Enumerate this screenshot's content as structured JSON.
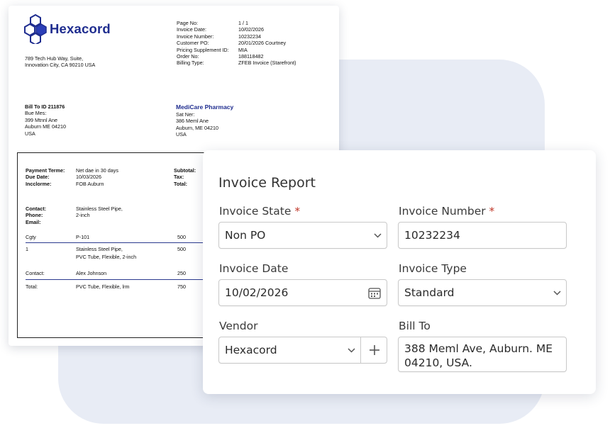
{
  "invoice_doc": {
    "company": "Hexacord",
    "address": [
      "789 Tech Hub Way, Suite,",
      "Innovation City, CA 90210 USA"
    ],
    "header_fields": [
      {
        "label": "Page No:",
        "value": "1  /  1"
      },
      {
        "label": "Invoice Date:",
        "value": "10/02/2026"
      },
      {
        "label": "Invoice Number:",
        "value": "10232234"
      },
      {
        "label": "Customer PO:",
        "value": "20/01/2026 Courtney"
      },
      {
        "label": "Pricing Supplement ID:",
        "value": "MIA"
      },
      {
        "label": "Order No:",
        "value": "188118482"
      },
      {
        "label": "Billing Type:",
        "value": "ZFEB Invoice (Starefront)"
      }
    ],
    "bill_to": {
      "heading": "Bill To ID 211876",
      "lines": [
        "Bue Mes:",
        "399 Mtnnl Ane",
        "Auburn ME 04210",
        "USA"
      ]
    },
    "ship_to": {
      "name": "MediCare Pharmacy",
      "lines": [
        "Sat Ner:",
        "386 Meml Ane",
        "Auburn, ME 04210",
        "USA"
      ]
    },
    "terms": [
      {
        "label": "Payment Terme:",
        "value": "Net dae in 30 days"
      },
      {
        "label": "Due Date:",
        "value": "10/03/2026"
      },
      {
        "label": "Incclorme:",
        "value": "FOB Auburn"
      }
    ],
    "totals_labels": [
      "Subtotal:",
      "Tax:",
      "Total:"
    ],
    "contact": [
      {
        "label": "Contact:",
        "value": "Stainless Steel Pipe,"
      },
      {
        "label": "Phone:",
        "value": "2-inch"
      },
      {
        "label": "Email:",
        "value": ""
      }
    ],
    "rows": [
      {
        "c1": "Cgty",
        "c2": "P-101",
        "c3": "500"
      },
      {
        "c1": "1",
        "c2": "Stainless Steel Pipe,",
        "c2b": "PVC Tube, Flexible, 2-inch",
        "c3": "500"
      },
      {
        "c1": "Contact:",
        "c2": "Alex Johnson",
        "c3": "250"
      },
      {
        "c1": "Total:",
        "c2": "PVC Tube, Flexible, lrm",
        "c3": "750"
      }
    ]
  },
  "form": {
    "title": "Invoice Report",
    "invoice_state": {
      "label": "Invoice State",
      "required_mark": "*",
      "value": "Non PO"
    },
    "invoice_number": {
      "label": "Invoice Number",
      "required_mark": "*",
      "value": "10232234"
    },
    "invoice_date": {
      "label": "Invoice Date",
      "value": "10/02/2026"
    },
    "invoice_type": {
      "label": "Invoice Type",
      "value": "Standard"
    },
    "vendor": {
      "label": "Vendor",
      "value": "Hexacord"
    },
    "bill_to": {
      "label": "Bill To",
      "value": "388 Meml Ave, Auburn. ME 04210, USA."
    }
  },
  "colors": {
    "brand": "#1f2d8f",
    "background_shape": "#e8ecf5",
    "required": "#c0392b"
  },
  "icons": [
    "hexacord-logo-icon",
    "chevron-down-icon",
    "calendar-icon",
    "plus-icon"
  ]
}
